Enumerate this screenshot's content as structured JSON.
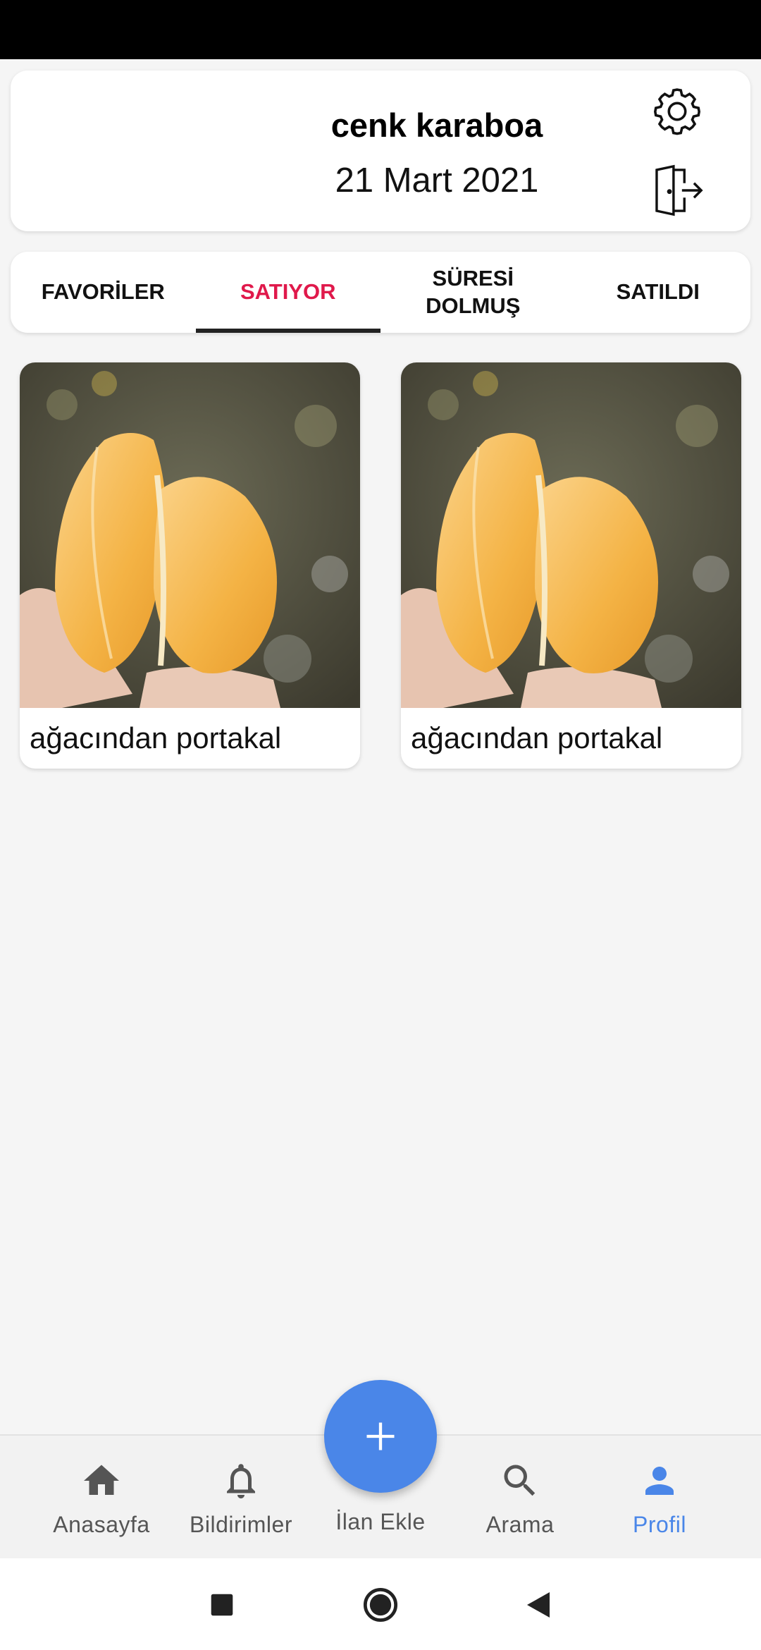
{
  "profile": {
    "name": "cenk karaboa",
    "date": "21 Mart 2021"
  },
  "tabs": [
    {
      "label": "FAVORİLER",
      "active": false
    },
    {
      "label": "SATIYOR",
      "active": true
    },
    {
      "label": "SÜRESİ\nDOLMUŞ",
      "active": false
    },
    {
      "label": "SATILDI",
      "active": false
    }
  ],
  "products": [
    {
      "title": "ağacından portakal",
      "image": "peeled-orange-photo"
    },
    {
      "title": "ağacından portakal",
      "image": "peeled-orange-photo"
    }
  ],
  "bottom_nav": {
    "home": "Anasayfa",
    "notifications": "Bildirimler",
    "add": "İlan Ekle",
    "search": "Arama",
    "profile": "Profil"
  },
  "colors": {
    "accent": "#4a86e8",
    "active_tab": "#e0194b"
  }
}
